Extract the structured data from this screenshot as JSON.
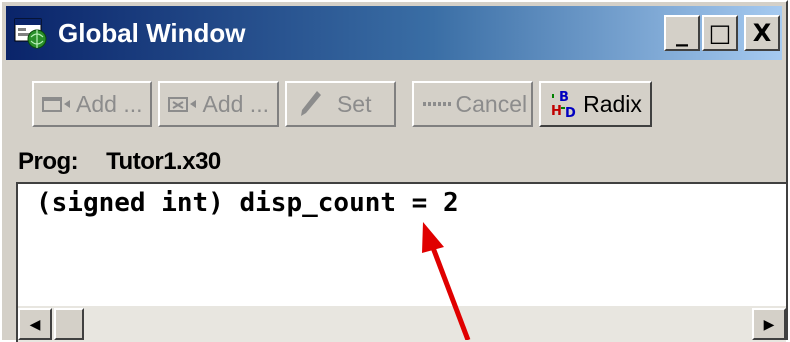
{
  "window": {
    "title": "Global Window",
    "controls": [
      "_",
      "□",
      "X"
    ]
  },
  "toolbar": {
    "add1_label": "Add ...",
    "add2_label": "Add ...",
    "set_label": "Set",
    "cancel_label": "Cancel",
    "radix_label": "Radix"
  },
  "prog": {
    "label": "Prog:",
    "file": "Tutor1.x30"
  },
  "content": {
    "line": "(signed int) disp_count = 2"
  },
  "colors": {
    "title_bar": "#0a246a",
    "annotation_arrow": "#e00000"
  }
}
